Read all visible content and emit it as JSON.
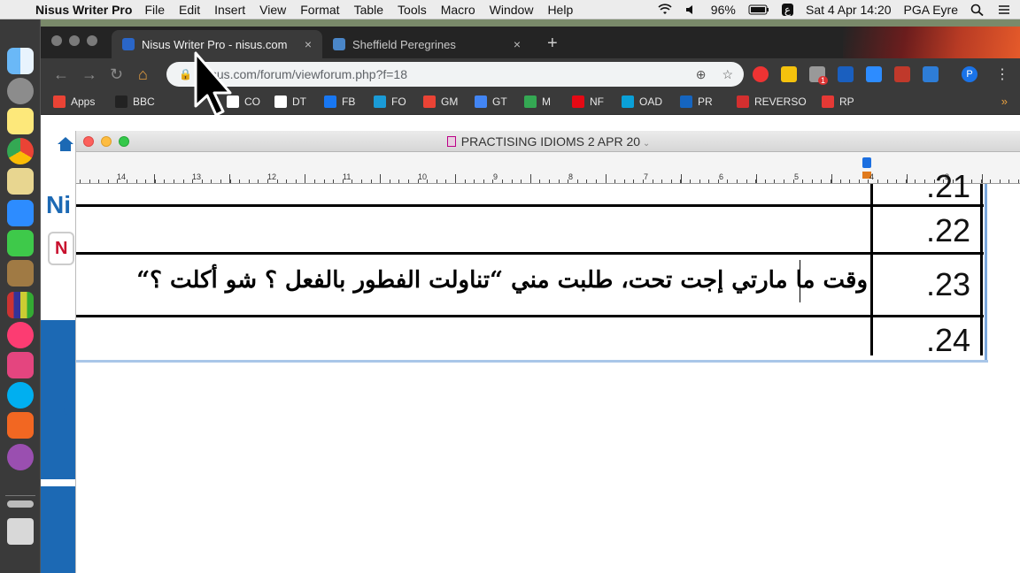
{
  "menubar": {
    "app_name": "Nisus Writer Pro",
    "menus": [
      "File",
      "Edit",
      "Insert",
      "View",
      "Format",
      "Table",
      "Tools",
      "Macro",
      "Window",
      "Help"
    ],
    "battery": "96%",
    "input_source": "ع",
    "datetime": "Sat 4 Apr  14:20",
    "user": "PGA Eyre"
  },
  "chrome": {
    "tabs": [
      {
        "label": "Nisus Writer Pro - nisus.com",
        "close": "×"
      },
      {
        "label": "Sheffield Peregrines",
        "close": "×"
      }
    ],
    "new_tab": "+",
    "url": "nisus.com/forum/viewforum.php?f=18",
    "profile_initial": "P",
    "bookmarks": [
      {
        "label": "Apps",
        "color": "#ea4335"
      },
      {
        "label": "BBC",
        "color": "#222222"
      },
      {
        "label": "CO",
        "color": "#ffffff"
      },
      {
        "label": "DT",
        "color": "#ffffff"
      },
      {
        "label": "FB",
        "color": "#1877f2"
      },
      {
        "label": "FO",
        "color": "#1a9bd7"
      },
      {
        "label": "GM",
        "color": "#ea4335"
      },
      {
        "label": "GT",
        "color": "#4285f4"
      },
      {
        "label": "M",
        "color": "#34a853"
      },
      {
        "label": "NF",
        "color": "#e50914"
      },
      {
        "label": "OAD",
        "color": "#0aa0d8"
      },
      {
        "label": "PR",
        "color": "#1565c0"
      },
      {
        "label": "REVERSO",
        "color": "#d32f2f"
      },
      {
        "label": "RP",
        "color": "#e53935"
      }
    ],
    "bookmark_more": "»",
    "extension_badge": "1"
  },
  "nisus": {
    "title": "PRACTISING IDIOMS  2 APR  20",
    "ruler_numbers": [
      "14",
      "13",
      "12",
      "11",
      "10",
      "9",
      "8",
      "7",
      "6",
      "5",
      "4",
      "3"
    ],
    "rows": [
      {
        "number": ".21",
        "text": ""
      },
      {
        "number": ".22",
        "text": ""
      },
      {
        "number": ".23",
        "text": "وقت ما مارتي إجت تحت، طلبت مني “تناولت الفطور بالفعل  ؟ شو أكلت ؟“"
      },
      {
        "number": ".24",
        "text": ""
      }
    ]
  },
  "page": {
    "partial_heading": "Ni",
    "partial_logo": "N"
  }
}
